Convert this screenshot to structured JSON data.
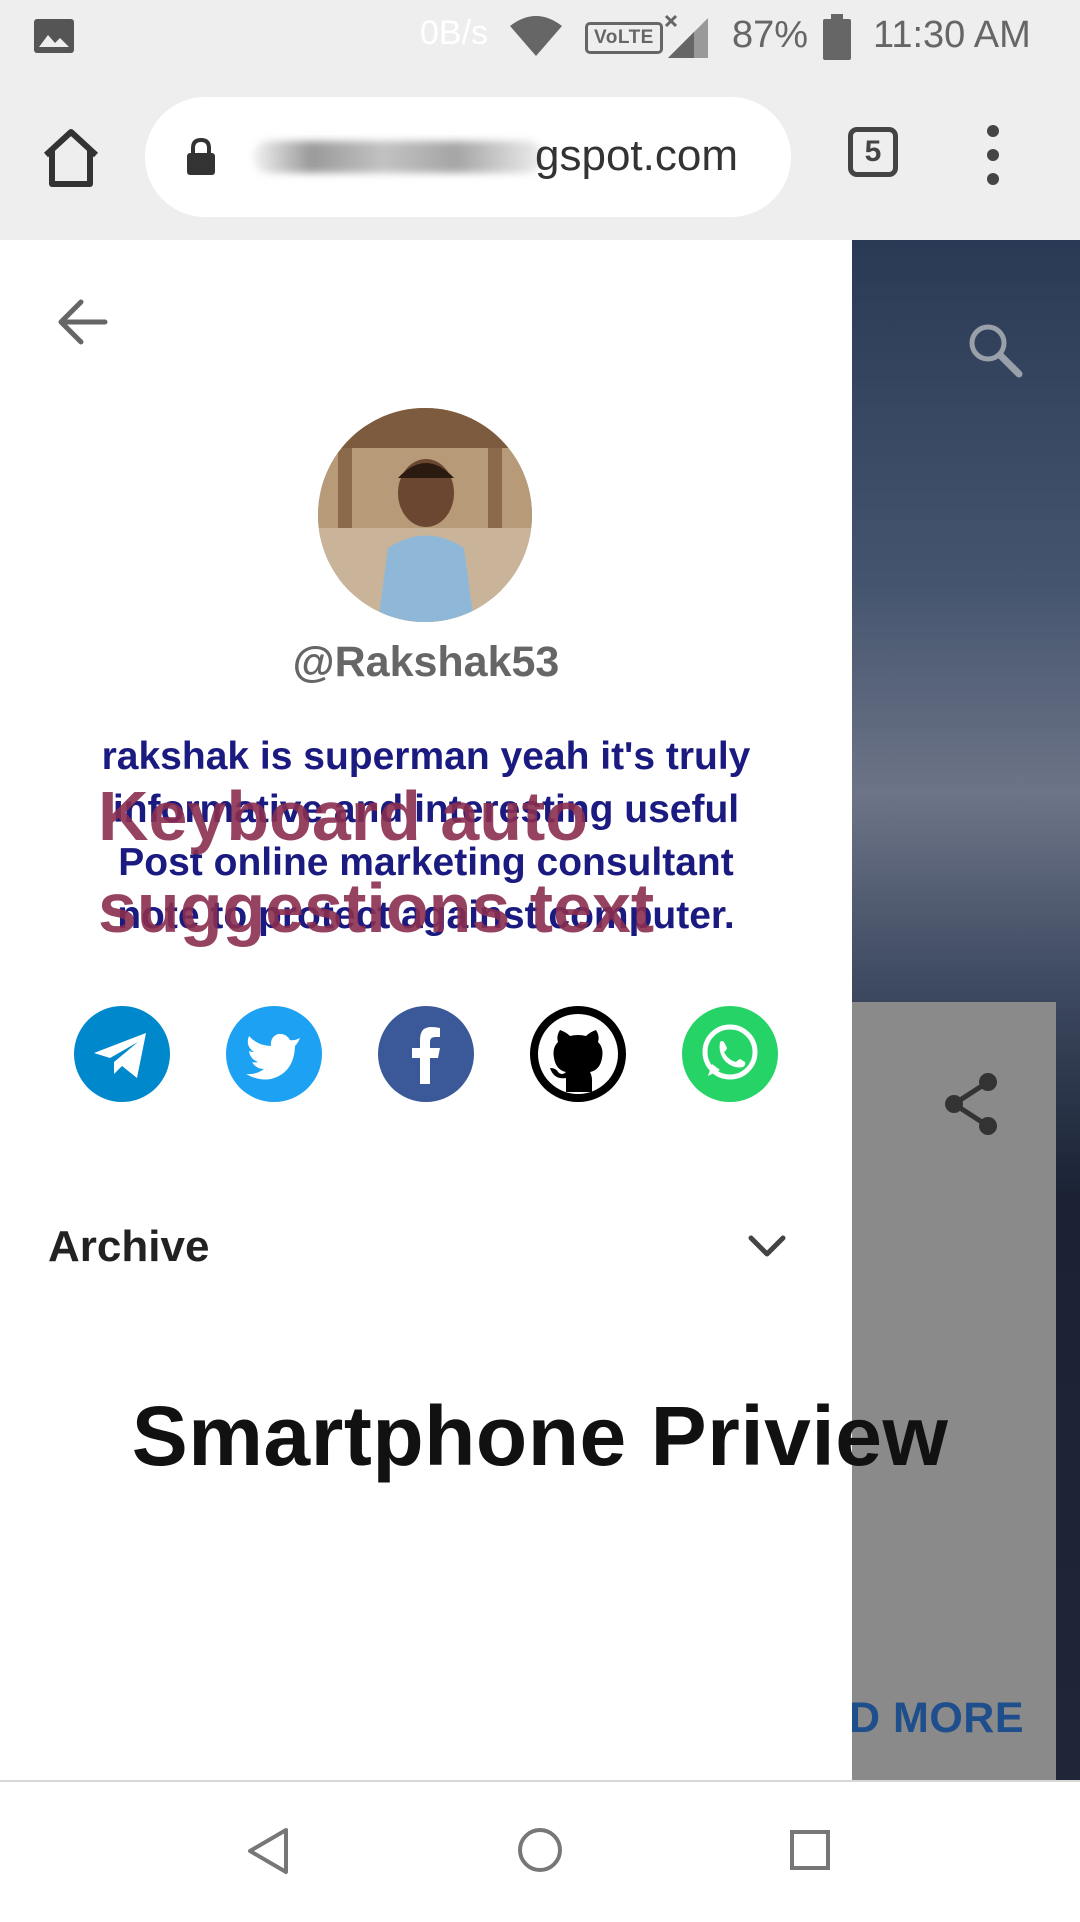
{
  "status_bar": {
    "net_speed": "0B/s",
    "volte": "VoLTE",
    "battery": "87%",
    "time": "11:30 AM",
    "icons": [
      "gallery-icon",
      "wifi-icon",
      "signal-icon",
      "battery-icon"
    ]
  },
  "browser": {
    "url_visible": "gspot.com",
    "tab_count": "5",
    "icons": [
      "home-icon",
      "lock-icon",
      "tabs-icon",
      "more-vert-icon"
    ]
  },
  "drawer": {
    "username": "@Rakshak53",
    "bio_lines": [
      "rakshak is superman yeah it's truly",
      "informative and interesting useful",
      "Post online marketing consultant",
      "note to protect against computer."
    ],
    "watermark_lines": [
      "Keyboard auto",
      "suggestions text"
    ],
    "social": [
      {
        "name": "telegram",
        "color": "#0088cc"
      },
      {
        "name": "twitter",
        "color": "#1da1f2"
      },
      {
        "name": "facebook",
        "color": "#3b5998"
      },
      {
        "name": "github",
        "color": "#000000"
      },
      {
        "name": "whatsapp",
        "color": "#25d366"
      }
    ],
    "archive_label": "Archive"
  },
  "background_page": {
    "read_more": "D MORE"
  },
  "caption": "Smartphone Priview",
  "colors": {
    "bio": "#1a1a80",
    "watermark": "#8b2e50",
    "read_more": "#1e4e8c"
  }
}
